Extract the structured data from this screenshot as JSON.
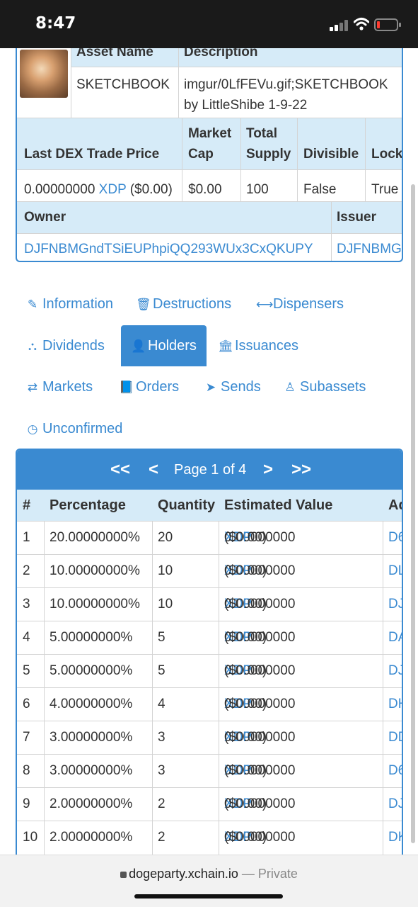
{
  "status_bar": {
    "time": "8:47"
  },
  "asset": {
    "header_asset_name": "Asset Name",
    "header_description": "Description",
    "asset_name": "SKETCHBOOK",
    "description_line1": "imgur/0LfFEVu.gif;SKETCHBOOK",
    "description_line2": "by LittleShibe 1-9-22",
    "h_last_price": "Last DEX Trade Price",
    "h_market_cap_1": "Market",
    "h_market_cap_2": "Cap",
    "h_total_supply_1": "Total",
    "h_total_supply_2": "Supply",
    "h_divisible": "Divisible",
    "h_locked": "Lock",
    "last_price_value": "0.00000000",
    "last_price_unit": "XDP",
    "last_price_usd": "($0.00)",
    "market_cap": "$0.00",
    "total_supply": "100",
    "divisible": "False",
    "locked": "True",
    "h_owner": "Owner",
    "h_issuer": "Issuer",
    "owner": "DJFNBMGndTSiEUPhpiQQ293WUx3CxQKUPY",
    "issuer": "DJFNBMG"
  },
  "tabs": [
    {
      "label": "Information",
      "icon": "paperclip-icon",
      "glyph": "✎"
    },
    {
      "label": "Destructions",
      "icon": "trash-icon",
      "glyph": "🗑"
    },
    {
      "label": "Dispensers",
      "icon": "arrows-horizontal-icon",
      "glyph": "⟷"
    },
    {
      "label": "Dividends",
      "icon": "sitemap-icon",
      "glyph": "⛬"
    },
    {
      "label": "Holders",
      "icon": "user-icon",
      "glyph": "👤"
    },
    {
      "label": "Issuances",
      "icon": "bank-icon",
      "glyph": "🏛"
    },
    {
      "label": "Markets",
      "icon": "exchange-icon",
      "glyph": "⇄"
    },
    {
      "label": "Orders",
      "icon": "book-icon",
      "glyph": "📘"
    },
    {
      "label": "Sends",
      "icon": "paper-plane-icon",
      "glyph": "➤"
    },
    {
      "label": "Subassets",
      "icon": "child-icon",
      "glyph": "♙"
    },
    {
      "label": "Unconfirmed",
      "icon": "clock-icon",
      "glyph": "◷"
    }
  ],
  "active_tab": "Holders",
  "pager": {
    "first": "<<",
    "prev": "<",
    "label": "Page 1 of 4",
    "next": ">",
    "last": ">>"
  },
  "holders_table": {
    "headers": [
      "#",
      "Percentage",
      "Quantity",
      "Estimated Value",
      "Ad"
    ],
    "value_unit": "XDP",
    "rows": [
      {
        "n": "1",
        "pct": "20.00000000%",
        "qty": "20",
        "val": "0.00000000",
        "usd": "($0.00)",
        "addr": "D6"
      },
      {
        "n": "2",
        "pct": "10.00000000%",
        "qty": "10",
        "val": "0.00000000",
        "usd": "($0.00)",
        "addr": "DL"
      },
      {
        "n": "3",
        "pct": "10.00000000%",
        "qty": "10",
        "val": "0.00000000",
        "usd": "($0.00)",
        "addr": "DJ"
      },
      {
        "n": "4",
        "pct": "5.00000000%",
        "qty": "5",
        "val": "0.00000000",
        "usd": "($0.00)",
        "addr": "DA"
      },
      {
        "n": "5",
        "pct": "5.00000000%",
        "qty": "5",
        "val": "0.00000000",
        "usd": "($0.00)",
        "addr": "DJ"
      },
      {
        "n": "6",
        "pct": "4.00000000%",
        "qty": "4",
        "val": "0.00000000",
        "usd": "($0.00)",
        "addr": "DH"
      },
      {
        "n": "7",
        "pct": "3.00000000%",
        "qty": "3",
        "val": "0.00000000",
        "usd": "($0.00)",
        "addr": "DD"
      },
      {
        "n": "8",
        "pct": "3.00000000%",
        "qty": "3",
        "val": "0.00000000",
        "usd": "($0.00)",
        "addr": "D6"
      },
      {
        "n": "9",
        "pct": "2.00000000%",
        "qty": "2",
        "val": "0.00000000",
        "usd": "($0.00)",
        "addr": "DJ"
      },
      {
        "n": "10",
        "pct": "2.00000000%",
        "qty": "2",
        "val": "0.00000000",
        "usd": "($0.00)",
        "addr": "DK"
      }
    ]
  },
  "browser": {
    "domain": "dogeparty.xchain.io",
    "separator": "—",
    "mode": "Private"
  },
  "colors": {
    "accent": "#3a8ad1",
    "header_bg": "#d6ebf8",
    "status_bar": "#1a1a1a"
  }
}
